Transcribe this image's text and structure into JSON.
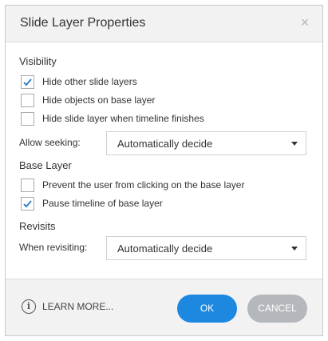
{
  "dialog": {
    "title": "Slide Layer Properties",
    "close_glyph": "×"
  },
  "visibility": {
    "heading": "Visibility",
    "options": [
      {
        "label": "Hide other slide layers",
        "checked": true
      },
      {
        "label": "Hide objects on base layer",
        "checked": false
      },
      {
        "label": "Hide slide layer when timeline finishes",
        "checked": false
      }
    ],
    "allow_seeking_label": "Allow seeking:",
    "allow_seeking_value": "Automatically decide"
  },
  "base_layer": {
    "heading": "Base Layer",
    "options": [
      {
        "label": "Prevent the user from clicking on the base layer",
        "checked": false
      },
      {
        "label": "Pause timeline of base layer",
        "checked": true
      }
    ]
  },
  "revisits": {
    "heading": "Revisits",
    "when_revisiting_label": "When revisiting:",
    "when_revisiting_value": "Automatically decide"
  },
  "footer": {
    "info_glyph": "i",
    "learn_more": "LEARN MORE...",
    "ok": "OK",
    "cancel": "CANCEL"
  },
  "colors": {
    "accent": "#1c88e0",
    "check": "#2b79c2",
    "cancel_button": "#b4b7bb"
  },
  "icons": [
    "close-icon",
    "checkmark-icon",
    "dropdown-caret-icon",
    "info-icon"
  ]
}
